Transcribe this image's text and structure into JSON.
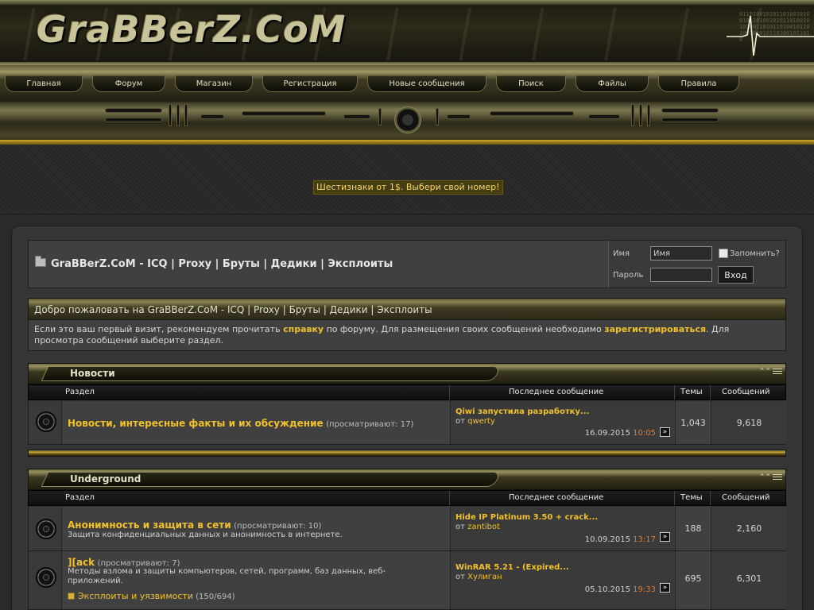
{
  "site": {
    "logo": "GraBBerZ.CoM",
    "binary_text": "0110100101011010010100101101001010110100101010011010110100101101001010101101001011010"
  },
  "nav": [
    {
      "label": "Главная"
    },
    {
      "label": "Форум"
    },
    {
      "label": "Магазин"
    },
    {
      "label": "Регистрация"
    },
    {
      "label": "Новые сообщения"
    },
    {
      "label": "Поиск"
    },
    {
      "label": "Файлы"
    },
    {
      "label": "Правила"
    }
  ],
  "banner": {
    "text": "Шестизнаки от 1$. Выбери свой номер!"
  },
  "breadcrumb": {
    "title": "GraBBerZ.CoM - ICQ | Proxy | Бруты | Дедики | Эксплоиты"
  },
  "login": {
    "username_label": "Имя",
    "username_value": "Имя",
    "password_label": "Пароль",
    "remember_label": "Запомнить?",
    "submit_label": "Вход"
  },
  "welcome": {
    "heading": "Добро пожаловать на GraBBerZ.CoM - ICQ | Proxy | Бруты | Дедики | Эксплоиты",
    "text_1": "Если это ваш первый визит, рекомендуем прочитать ",
    "link_help": "справку",
    "text_2": " по форуму. Для размещения своих сообщений необходимо ",
    "link_register": "зарегистрироваться",
    "text_3": ". Для просмотра сообщений выберите раздел."
  },
  "columns": {
    "section": "Раздел",
    "last_post": "Последнее сообщение",
    "threads": "Темы",
    "posts": "Сообщений"
  },
  "categories": [
    {
      "title": "Новости",
      "forums": [
        {
          "title": "Новости, интересные факты и их обсуждение",
          "viewing": "(просматривают: 17)",
          "last_title": "Qiwi запустила разработку...",
          "last_by_prefix": "от ",
          "last_by": "qwerty",
          "last_date": "16.09.2015",
          "last_time": "10:05",
          "threads": "1,043",
          "posts": "9,618"
        }
      ]
    },
    {
      "title": "Underground",
      "forums": [
        {
          "title": "Анонимность и защита в сети",
          "viewing": "(просматривают: 10)",
          "desc": "Защита конфиденциальных данных и анонимность в интернете.",
          "last_title": "Hide IP Platinum 3.50 + crack...",
          "last_by_prefix": "от ",
          "last_by": "zantibot",
          "last_date": "10.09.2015",
          "last_time": "13:17",
          "threads": "188",
          "posts": "2,160"
        },
        {
          "title": "][ack",
          "viewing": "(просматривают: 7)",
          "desc": "Методы взлома и защиты компьютеров, сетей, программ, баз данных, веб-приложений.",
          "subforum": "Эксплоиты и уязвимости",
          "subforum_counts": "(150/694)",
          "last_title": "WinRAR 5.21 - (Expired...",
          "last_by_prefix": "от ",
          "last_by": "Хулиган",
          "last_date": "05.10.2015",
          "last_time": "19:33",
          "threads": "695",
          "posts": "6,301"
        }
      ]
    }
  ],
  "colors": {
    "accent": "#f0c12a",
    "time": "#e07a2a",
    "header_gold": "#9e9765"
  }
}
